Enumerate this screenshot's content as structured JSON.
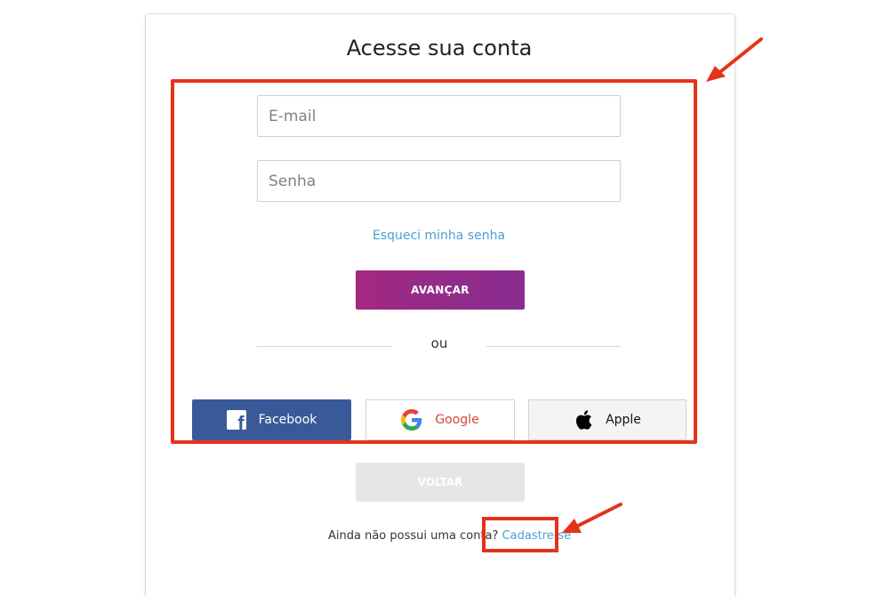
{
  "page": {
    "title": "Acesse sua conta"
  },
  "form": {
    "email_placeholder": "E-mail",
    "password_placeholder": "Senha",
    "forgot_password": "Esqueci minha senha",
    "submit_label": "AVANÇAR",
    "divider_text": "ou"
  },
  "social": {
    "facebook": "Facebook",
    "google": "Google",
    "apple": "Apple"
  },
  "footer": {
    "back_label": "VOLTAR",
    "signup_prompt": "Ainda não possui uma conta?",
    "signup_link": "Cadastre-se"
  },
  "colors": {
    "annotation_red": "#e5331a",
    "primary_purple": "#922c8a",
    "facebook_blue": "#3a5998",
    "link_blue": "#4b9fd5"
  },
  "icons": {
    "facebook": "facebook-icon",
    "google": "google-icon",
    "apple": "apple-icon",
    "annotation_arrow": "red-arrow-icon"
  }
}
